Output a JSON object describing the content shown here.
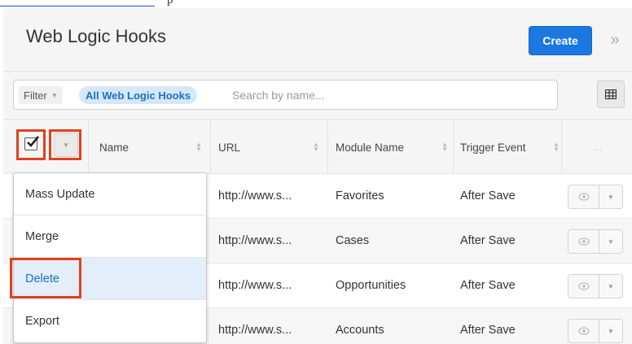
{
  "top_fragment": {
    "word": "p"
  },
  "header": {
    "title": "Web Logic Hooks",
    "create_label": "Create",
    "collapse_glyph": "»"
  },
  "filter": {
    "filter_label": "Filter",
    "chip_label": "All Web Logic Hooks",
    "search_placeholder": "Search by name..."
  },
  "table": {
    "columns": [
      "Name",
      "URL",
      "Module Name",
      "Trigger Event"
    ],
    "more_glyph": "...",
    "rows": [
      {
        "url": "http://www.s...",
        "module": "Favorites",
        "trigger": "After Save"
      },
      {
        "url": "http://www.s...",
        "module": "Cases",
        "trigger": "After Save"
      },
      {
        "url": "http://www.s...",
        "module": "Opportunities",
        "trigger": "After Save"
      },
      {
        "url": "http://www.s...",
        "module": "Accounts",
        "trigger": "After Save"
      }
    ]
  },
  "mass_actions_menu": {
    "items": [
      "Mass Update",
      "Merge",
      "Delete",
      "Export"
    ],
    "active_item": "Delete"
  },
  "colors": {
    "accent": "#1a78e0",
    "highlight": "#e33f1e",
    "chip_bg": "#d6e8f8"
  }
}
